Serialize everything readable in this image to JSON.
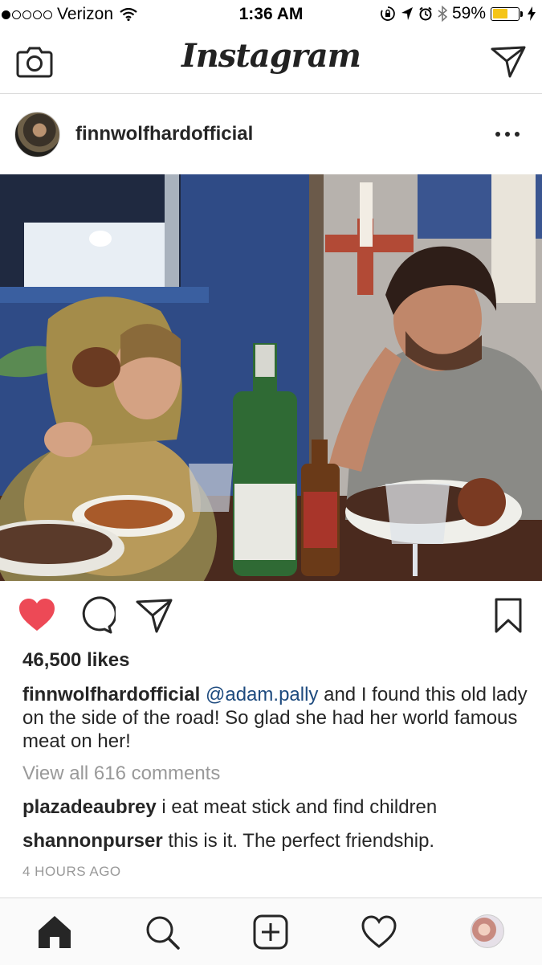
{
  "status_bar": {
    "carrier": "Verizon",
    "time": "1:36 AM",
    "battery": "59%",
    "signal_dots_filled": 1,
    "signal_dots_total": 5,
    "battery_level": 0.59,
    "battery_color": "#f5c518"
  },
  "nav": {
    "logo": "Instagram",
    "left_icon": "camera-icon",
    "right_icon": "paper-plane-icon"
  },
  "post": {
    "username": "finnwolfhardofficial",
    "likes": "46,500 likes",
    "caption": {
      "username": "finnwolfhardofficial",
      "mention": "@adam.pally",
      "text": " and I found this old lady on the side of the road! So glad she had her world famous meat on her!"
    },
    "view_all_comments": "View all 616 comments",
    "comments": [
      {
        "user": "plazadeaubrey",
        "text": " i eat meat stick and find children"
      },
      {
        "user": "shannonpurser",
        "text": " this is it. The perfect friendship."
      }
    ],
    "timestamp": "4 HOURS AGO",
    "liked": true,
    "like_color": "#ed4956"
  },
  "tabs": [
    "home-icon",
    "search-icon",
    "add-post-icon",
    "activity-heart-icon",
    "profile-avatar"
  ]
}
